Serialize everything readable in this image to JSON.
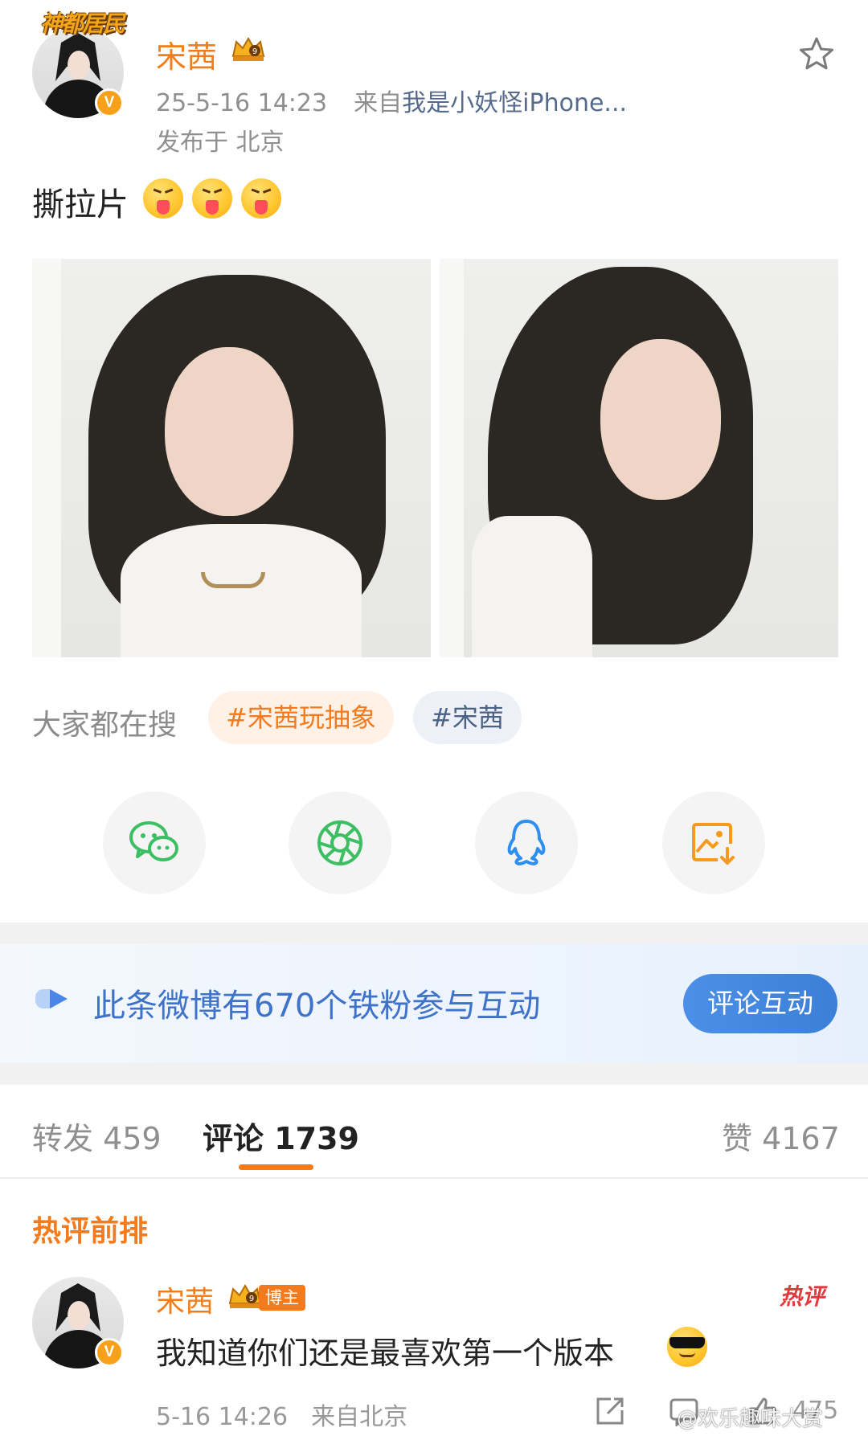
{
  "post": {
    "author": "宋茜",
    "brand_logo_text": "神都居民",
    "verified_badge": "V",
    "timestamp": "25-5-16 14:23",
    "source_prefix": "来自",
    "source": "我是小妖怪iPhone...",
    "location": "发布于 北京",
    "text": "撕拉片",
    "emojis": [
      "tongue-out",
      "tongue-out",
      "tongue-out"
    ],
    "photos": [
      "photo-front-portrait",
      "photo-side-portrait"
    ]
  },
  "trending": {
    "label": "大家都在搜",
    "tags": [
      "#宋茜玩抽象",
      "#宋茜"
    ]
  },
  "share": {
    "buttons": [
      "wechat-icon",
      "moments-icon",
      "qq-icon",
      "save-image-icon"
    ]
  },
  "fans": {
    "text": "此条微博有670个铁粉参与互动",
    "button": "评论互动"
  },
  "tabs": {
    "repost": "转发 459",
    "comments": "评论 1739",
    "likes": "赞 4167"
  },
  "hot_comments": {
    "title": "热评前排",
    "hot_badge": "热评",
    "items": [
      {
        "author": "宋茜",
        "badge": "博主",
        "text": "我知道你们还是最喜欢第一个版本",
        "time": "5-16 14:26",
        "location": "来自北京",
        "likes": "475"
      }
    ]
  },
  "watermark": "@欢乐趣味大赏",
  "colors": {
    "accent_orange": "#f47a1c",
    "link_blue": "#556a8c",
    "fans_blue": "#3f72c9"
  }
}
